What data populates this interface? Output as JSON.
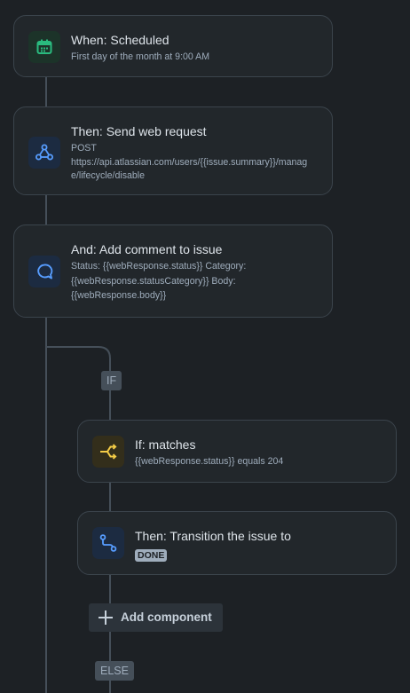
{
  "trigger": {
    "title": "When: Scheduled",
    "desc": "First day of the month at 9:00 AM"
  },
  "web_request": {
    "title": "Then: Send web request",
    "method": "POST",
    "url_line1": "https://api.atlassian.com/users/{{issue.summary}}/manag",
    "url_line2": "e/lifecycle/disable"
  },
  "comment": {
    "title": "And: Add comment to issue",
    "line1": "Status: {{webResponse.status}} Category:",
    "line2": "{{webResponse.statusCategory}} Body:",
    "line3": "{{webResponse.body}}"
  },
  "branch": {
    "if_label": "IF",
    "else_label": "ELSE"
  },
  "condition": {
    "title": "If: matches",
    "desc": "{{webResponse.status}} equals 204"
  },
  "transition": {
    "title": "Then: Transition the issue to",
    "status": "DONE"
  },
  "add_component": {
    "label": "Add component"
  },
  "colors": {
    "background": "#1d2125",
    "card": "#22272b",
    "trigger_icon": "#2abb7f",
    "action_icon": "#579dff",
    "condition_icon": "#f5cd47"
  }
}
